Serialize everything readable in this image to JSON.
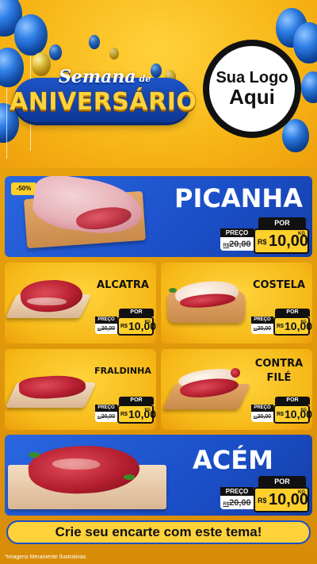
{
  "header": {
    "title_small": "Semana",
    "title_de": "de",
    "title_big": "ANIVERSÁRIO",
    "logo_line1": "Sua Logo",
    "logo_line2": "Aqui"
  },
  "products": [
    {
      "name": "PICANHA",
      "badge": "-50%",
      "por": "POR",
      "preco": "PREÇO",
      "old_currency": "R$",
      "old_price": "20,00",
      "currency": "R$",
      "price": "10,00",
      "unit": "KG"
    },
    {
      "name": "ALCATRA",
      "por": "POR",
      "preco": "PREÇO",
      "old_currency": "R$",
      "old_price": "20,00",
      "currency": "R$",
      "price": "10,00",
      "unit": "KG"
    },
    {
      "name": "COSTELA",
      "por": "POR",
      "preco": "PREÇO",
      "old_currency": "R$",
      "old_price": "20,00",
      "currency": "R$",
      "price": "10,00",
      "unit": "KG"
    },
    {
      "name": "FRALDINHA",
      "por": "POR",
      "preco": "PREÇO",
      "old_currency": "R$",
      "old_price": "20,00",
      "currency": "R$",
      "price": "10,00",
      "unit": "KG"
    },
    {
      "name_line1": "CONTRA",
      "name_line2": "FILÉ",
      "por": "POR",
      "preco": "PREÇO",
      "old_currency": "R$",
      "old_price": "20,00",
      "currency": "R$",
      "price": "10,00",
      "unit": "KG"
    },
    {
      "name": "ACÉM",
      "por": "POR",
      "preco": "PREÇO",
      "old_currency": "R$",
      "old_price": "20,00",
      "currency": "R$",
      "price": "10,00",
      "unit": "KG"
    }
  ],
  "cta": "Crie seu encarte com este tema!",
  "footnote": "*Imagens Meramente Ilustrativas",
  "colors": {
    "blue": "#1b4fc9",
    "yellow": "#ffcf2c",
    "orange": "#e6a20e"
  }
}
